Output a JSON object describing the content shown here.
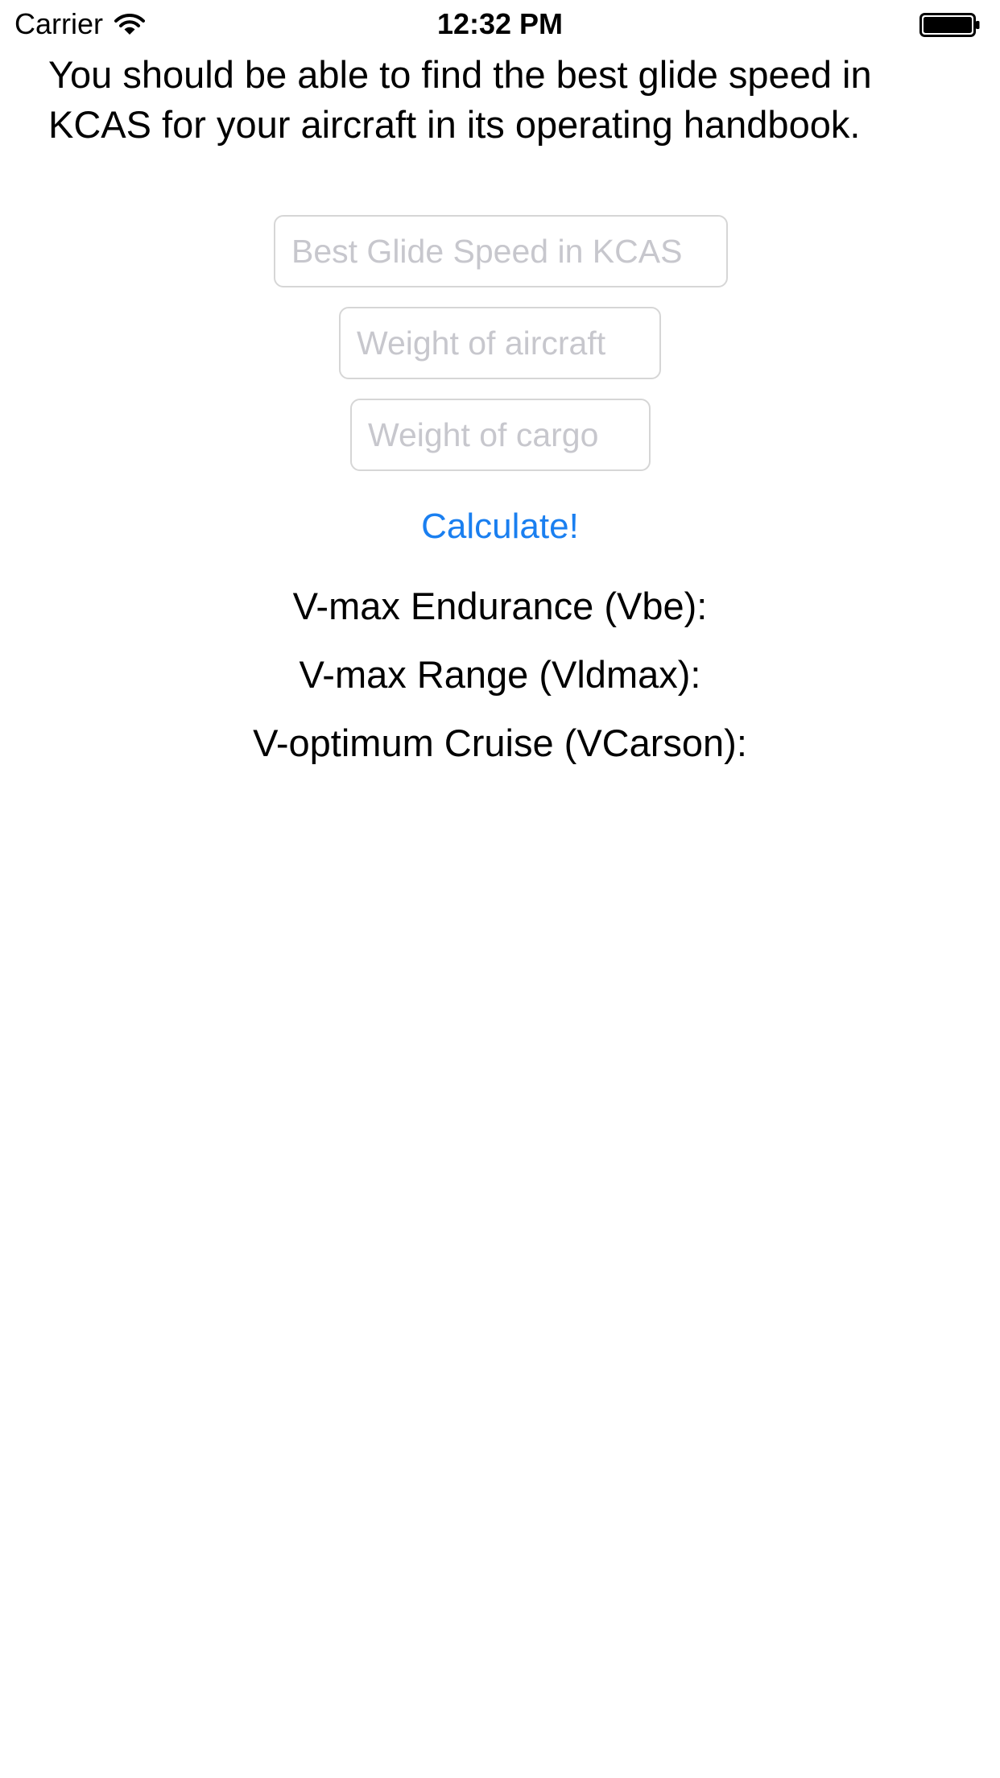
{
  "status_bar": {
    "carrier": "Carrier",
    "time": "12:32 PM",
    "wifi_icon": "wifi-icon",
    "battery_icon": "battery-icon"
  },
  "instructions": "You should be able to find the best glide speed in KCAS for your aircraft in its operating handbook.",
  "fields": {
    "glide_speed": {
      "placeholder": "Best Glide Speed in KCAS",
      "value": ""
    },
    "aircraft_weight": {
      "placeholder": "Weight of aircraft",
      "value": ""
    },
    "cargo_weight": {
      "placeholder": "Weight of cargo",
      "value": ""
    }
  },
  "calculate_label": "Calculate!",
  "results": {
    "vbe": "V-max Endurance (Vbe):",
    "vldmax": "V-max Range (Vldmax):",
    "vcarson": "V-optimum Cruise (VCarson):"
  },
  "colors": {
    "accent": "#1a7ff0",
    "placeholder": "#c7c7cd",
    "field_border": "#d6d6d6"
  }
}
